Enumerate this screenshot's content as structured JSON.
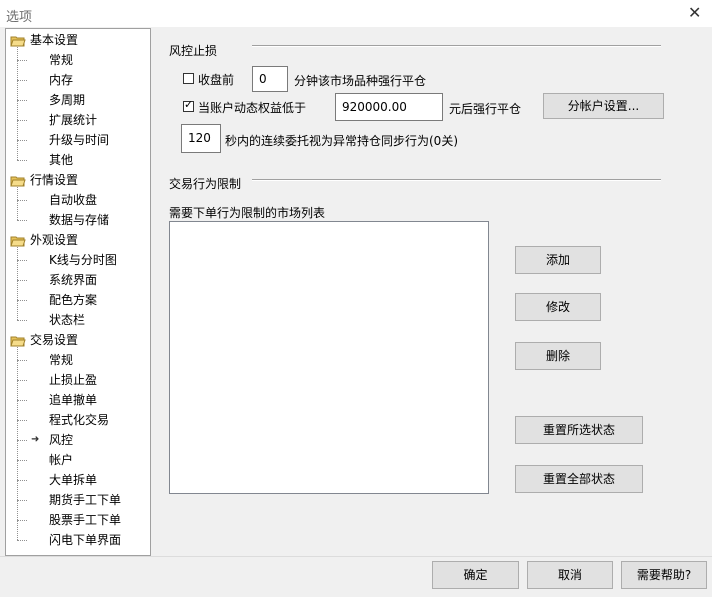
{
  "window": {
    "title": "选项"
  },
  "tree": {
    "items": [
      {
        "label": "基本设置",
        "level": 0
      },
      {
        "label": "常规",
        "level": 1
      },
      {
        "label": "内存",
        "level": 1
      },
      {
        "label": "多周期",
        "level": 1
      },
      {
        "label": "扩展统计",
        "level": 1
      },
      {
        "label": "升级与时间",
        "level": 1
      },
      {
        "label": "其他",
        "level": 1
      },
      {
        "label": "行情设置",
        "level": 0
      },
      {
        "label": "自动收盘",
        "level": 1
      },
      {
        "label": "数据与存储",
        "level": 1
      },
      {
        "label": "外观设置",
        "level": 0
      },
      {
        "label": "K线与分时图",
        "level": 1
      },
      {
        "label": "系统界面",
        "level": 1
      },
      {
        "label": "配色方案",
        "level": 1
      },
      {
        "label": "状态栏",
        "level": 1
      },
      {
        "label": "交易设置",
        "level": 0
      },
      {
        "label": "常规",
        "level": 1
      },
      {
        "label": "止损止盈",
        "level": 1
      },
      {
        "label": "追单撤单",
        "level": 1
      },
      {
        "label": "程式化交易",
        "level": 1
      },
      {
        "label": "风控",
        "level": 1,
        "selected": true
      },
      {
        "label": "帐户",
        "level": 1
      },
      {
        "label": "大单拆单",
        "level": 1
      },
      {
        "label": "期货手工下单",
        "level": 1
      },
      {
        "label": "股票手工下单",
        "level": 1
      },
      {
        "label": "闪电下单界面",
        "level": 1
      }
    ]
  },
  "risk": {
    "section_title": "风控止损",
    "row1": {
      "checked": false,
      "label": "收盘前",
      "value": "0",
      "suffix": "分钟该市场品种强行平仓"
    },
    "row2": {
      "checked": true,
      "label": "当账户动态权益低于",
      "value": "920000.00",
      "suffix": "元后强行平仓",
      "button": "分帐户设置..."
    },
    "row3": {
      "value": "120",
      "suffix": "秒内的连续委托视为异常持仓同步行为(0关)"
    }
  },
  "trade_limit": {
    "section_title": "交易行为限制",
    "list_label": "需要下单行为限制的市场列表",
    "buttons": {
      "add": "添加",
      "modify": "修改",
      "delete": "删除",
      "reset_selected": "重置所选状态",
      "reset_all": "重置全部状态"
    }
  },
  "footer": {
    "ok": "确定",
    "cancel": "取消",
    "help": "需要帮助?"
  }
}
